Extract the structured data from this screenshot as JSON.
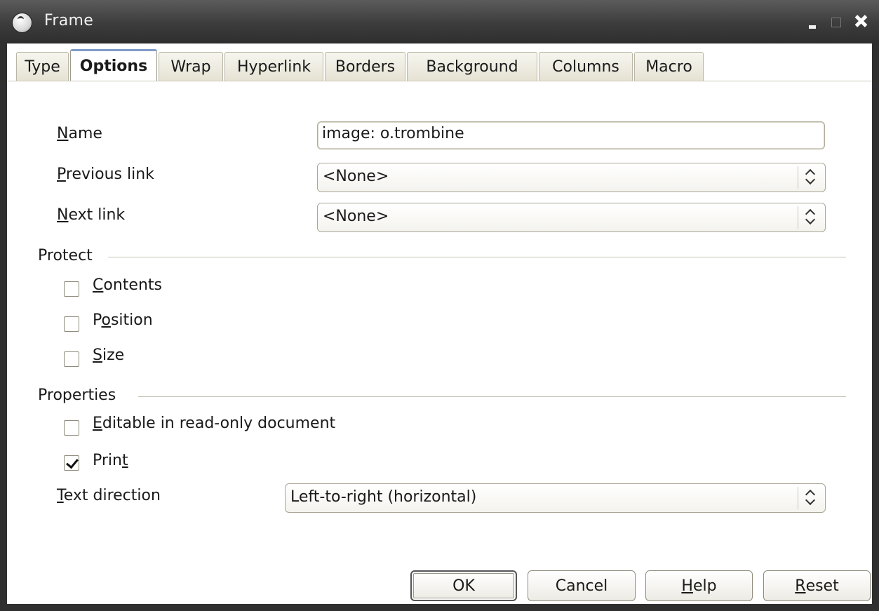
{
  "window": {
    "title": "Frame"
  },
  "tabs": [
    {
      "label": "Type",
      "active": false
    },
    {
      "label": "Options",
      "active": true
    },
    {
      "label": "Wrap",
      "active": false
    },
    {
      "label": "Hyperlink",
      "active": false
    },
    {
      "label": "Borders",
      "active": false
    },
    {
      "label": "Background",
      "active": false
    },
    {
      "label": "Columns",
      "active": false
    },
    {
      "label": "Macro",
      "active": false
    }
  ],
  "fields": {
    "name": {
      "mnemonic": "N",
      "label_rest": "ame",
      "value": "image: o.trombine"
    },
    "previous_link": {
      "mnemonic": "P",
      "label_rest": "revious link",
      "value": "<None>"
    },
    "next_link": {
      "mnemonic": "N",
      "label_rest": "ext link",
      "value": "<None>"
    }
  },
  "protect": {
    "title": "Protect",
    "contents": {
      "mnemonic": "C",
      "label_rest": "ontents",
      "checked": false
    },
    "position": {
      "pre": "P",
      "mnemonic": "o",
      "label_rest": "sition",
      "checked": false
    },
    "size": {
      "mnemonic": "S",
      "label_rest": "ize",
      "checked": false
    }
  },
  "properties": {
    "title": "Properties",
    "editable": {
      "mnemonic": "E",
      "label_rest": "ditable in read-only document",
      "checked": false
    },
    "print": {
      "pre": "Prin",
      "mnemonic": "t",
      "label_rest": "",
      "checked": true
    },
    "text_direction": {
      "mnemonic": "T",
      "label_rest": "ext direction",
      "value": "Left-to-right (horizontal)"
    }
  },
  "buttons": {
    "ok": "OK",
    "cancel": "Cancel",
    "help": {
      "mnemonic": "H",
      "rest": "elp"
    },
    "reset": {
      "mnemonic": "R",
      "rest": "eset"
    }
  }
}
